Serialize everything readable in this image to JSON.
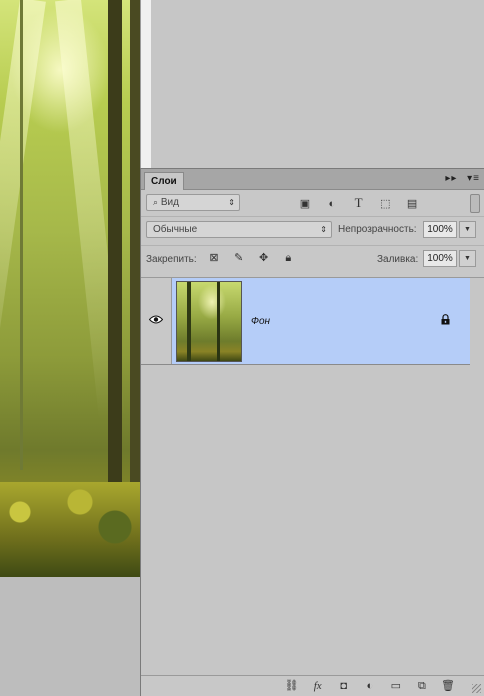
{
  "panel": {
    "tab_label": "Слои",
    "tab_actions": [
      "▸▸",
      "▾≡"
    ]
  },
  "filter": {
    "kind_label": "Вид",
    "icons": [
      "image-filter-icon",
      "adjustment-filter-icon",
      "type-filter-icon",
      "shape-filter-icon",
      "smart-object-filter-icon"
    ]
  },
  "blend": {
    "mode": "Обычные",
    "opacity_label": "Непрозрачность:",
    "opacity_value": "100%"
  },
  "lock": {
    "label": "Закрепить:",
    "icons": [
      "lock-transparent-pixels-icon",
      "lock-image-pixels-icon",
      "lock-position-icon",
      "lock-all-icon"
    ],
    "fill_label": "Заливка:",
    "fill_value": "100%"
  },
  "layers": [
    {
      "name": "Фон",
      "visible": true,
      "locked": true,
      "selected": true
    }
  ],
  "footer_icons": [
    "link-layers-icon",
    "fx-icon",
    "mask-icon",
    "adjustment-layer-icon",
    "group-folder-icon",
    "new-layer-icon",
    "trash-icon"
  ],
  "colors": {
    "panel_bg": "#c8c8c8",
    "selected_layer": "#b5cdf8",
    "tabbar": "#a6a6a6"
  }
}
